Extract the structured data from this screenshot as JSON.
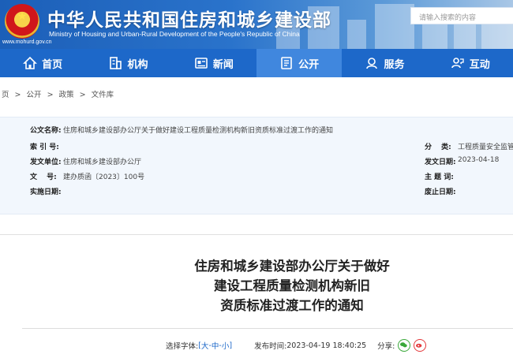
{
  "header": {
    "title": "中华人民共和国住房和城乡建设部",
    "subtitle": "Ministry of Housing and Urban-Rural Development of the People's Republic of China",
    "url": "www.mohurd.gov.cn",
    "search_placeholder": "请输入搜索的内容"
  },
  "nav": {
    "items": [
      {
        "label": "首页",
        "icon": "home-icon"
      },
      {
        "label": "机构",
        "icon": "building-icon"
      },
      {
        "label": "新闻",
        "icon": "news-icon"
      },
      {
        "label": "公开",
        "icon": "disclosure-icon",
        "active": true
      },
      {
        "label": "服务",
        "icon": "service-icon"
      },
      {
        "label": "互动",
        "icon": "interaction-icon"
      }
    ]
  },
  "breadcrumb": {
    "items": [
      "页",
      "公开",
      "政策",
      "文件库"
    ],
    "separator": ">"
  },
  "meta": {
    "doc_name_label": "公文名称:",
    "doc_name": "住房和城乡建设部办公厅关于做好建设工程质量检测机构新旧资质标准过渡工作的通知",
    "index_label": "索 引 号:",
    "index_value": "",
    "category_label": "分　 类:",
    "category_value": "工程质量安全监管",
    "issuer_label": "发文单位:",
    "issuer_value": "住房和城乡建设部办公厅",
    "issue_date_label": "发文日期:",
    "issue_date_value": "2023-04-18",
    "number_label": "文　 号:",
    "number_value": "建办质函〔2023〕100号",
    "keywords_label": "主 题 词:",
    "keywords_value": "",
    "effective_label": "实施日期:",
    "effective_value": "",
    "repeal_label": "废止日期:",
    "repeal_value": ""
  },
  "article": {
    "title_lines": [
      "住房和城乡建设部办公厅关于做好",
      "建设工程质量检测机构新旧",
      "资质标准过渡工作的通知"
    ]
  },
  "tools": {
    "font_label": "选择字体:",
    "open_bracket": "[",
    "size_large": "大",
    "sep1": "-",
    "size_medium": "中",
    "sep2": "-",
    "size_small": "小",
    "close_bracket": "]",
    "publish_label": "发布时间:",
    "publish_time": "2023-04-19 18:40:25",
    "share_label": "分享:"
  },
  "colors": {
    "nav_bg": "#1d68c9",
    "nav_active": "#4087de",
    "meta_bg": "#f2f7fd",
    "wechat": "#39a839",
    "weibo": "#e3383b"
  }
}
